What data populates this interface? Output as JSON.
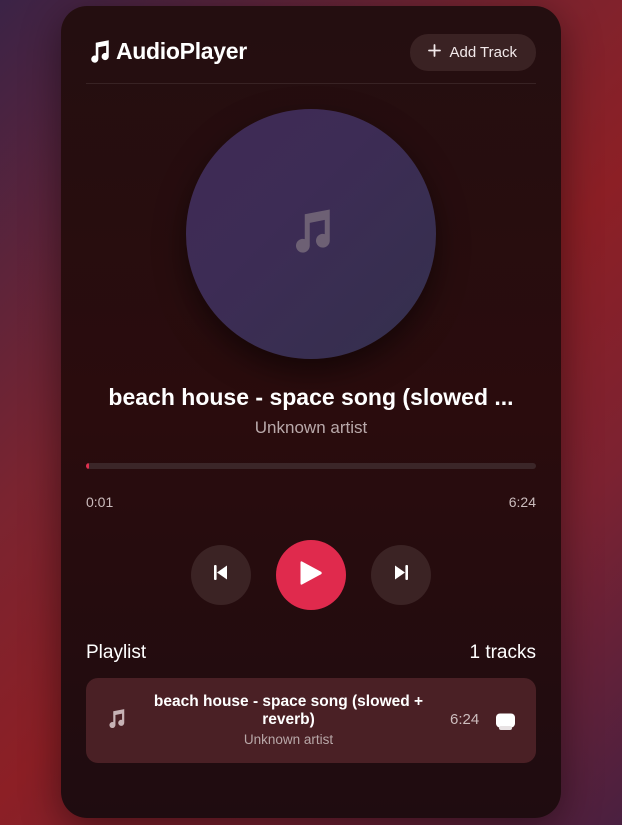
{
  "header": {
    "brand_title": "AudioPlayer",
    "add_track_label": "Add Track",
    "brand_icon": "music-note-icon",
    "add_icon": "plus-icon"
  },
  "now_playing": {
    "title": "beach house - space song (slowed ...",
    "artist": "Unknown artist",
    "current_time": "0:01",
    "duration": "6:24",
    "progress_fraction": 0.003
  },
  "controls": {
    "prev_icon": "skip-back-icon",
    "play_icon": "play-icon",
    "next_icon": "skip-forward-icon"
  },
  "playlist": {
    "label": "Playlist",
    "count_label": "1 tracks",
    "items": [
      {
        "title": "beach house - space song (slowed + reverb)",
        "artist": "Unknown artist",
        "duration": "6:24",
        "icon": "music-note-icon",
        "action_icon": "delete-icon"
      }
    ]
  },
  "colors": {
    "accent": "#e02a4d",
    "card_bg": "#240e10",
    "disc": "#3f2a55"
  }
}
